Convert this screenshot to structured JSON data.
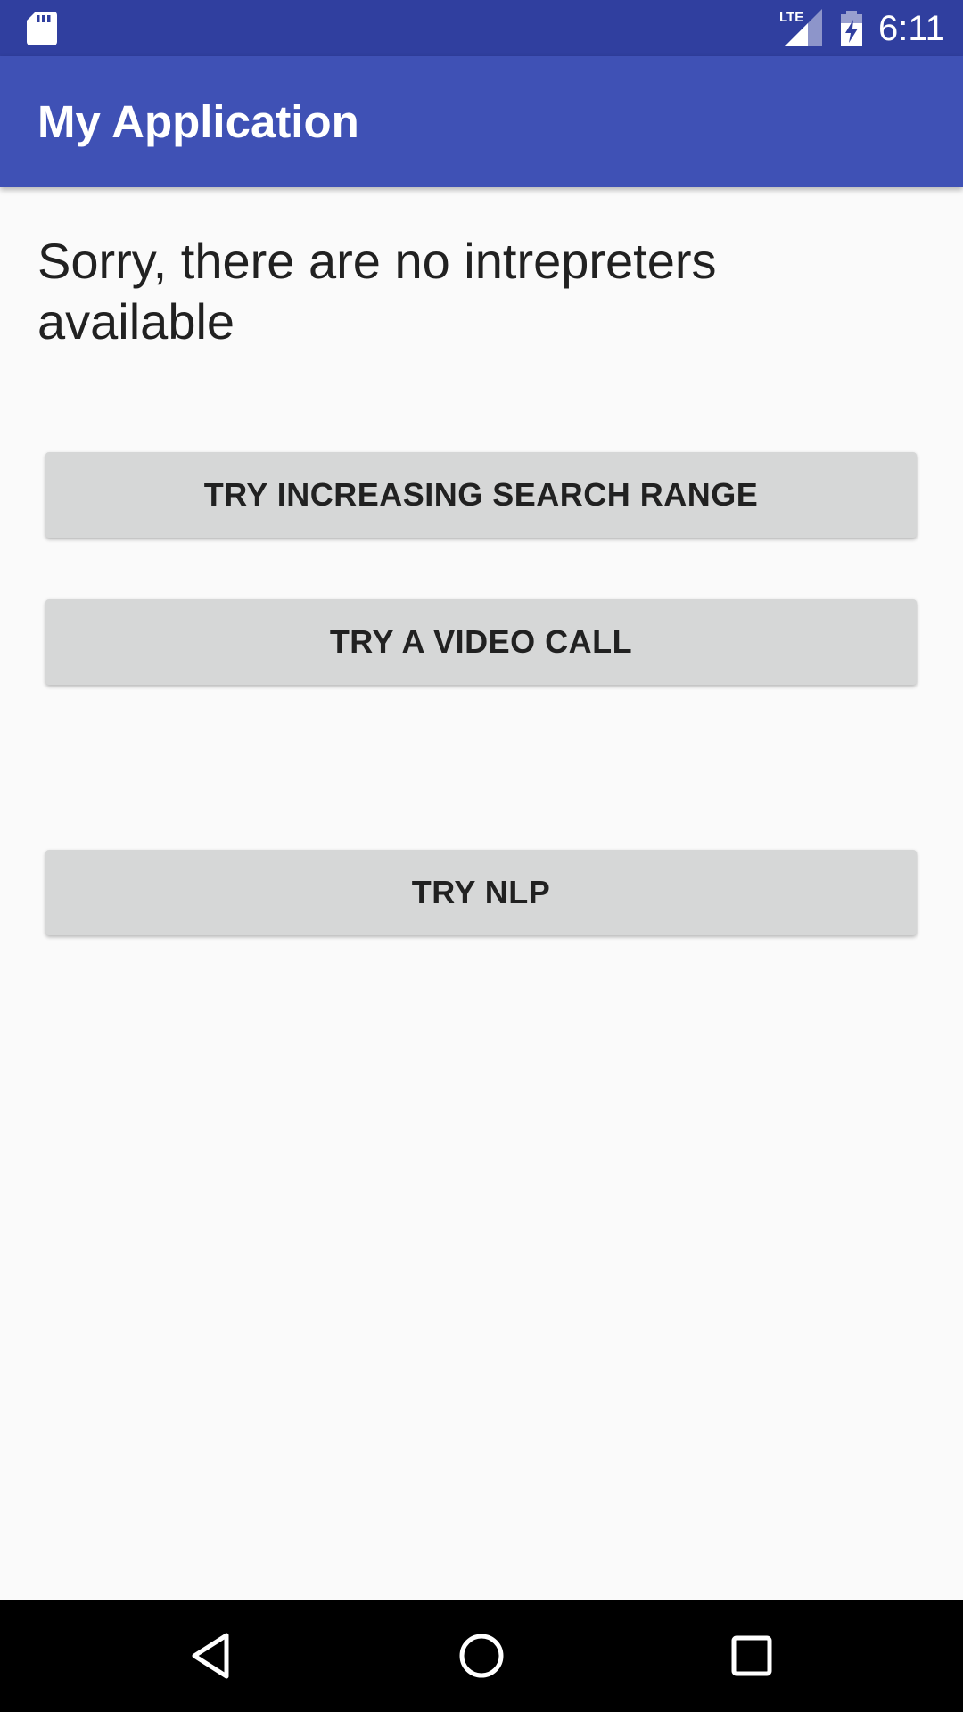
{
  "status_bar": {
    "time": "6:11",
    "network_label": "LTE",
    "icons": [
      "sd-card-icon",
      "lte-signal-icon",
      "battery-charging-icon"
    ]
  },
  "app_bar": {
    "title": "My Application",
    "color": "#3f51b5",
    "status_color": "#303f9f"
  },
  "main": {
    "message": "Sorry, there are no intrepreters available",
    "buttons": {
      "increase_range": "TRY INCREASING SEARCH RANGE",
      "video_call": "TRY A VIDEO CALL",
      "nlp": "TRY NLP"
    }
  },
  "nav_bar": {
    "icons": [
      "back-icon",
      "home-icon",
      "recents-icon"
    ]
  }
}
